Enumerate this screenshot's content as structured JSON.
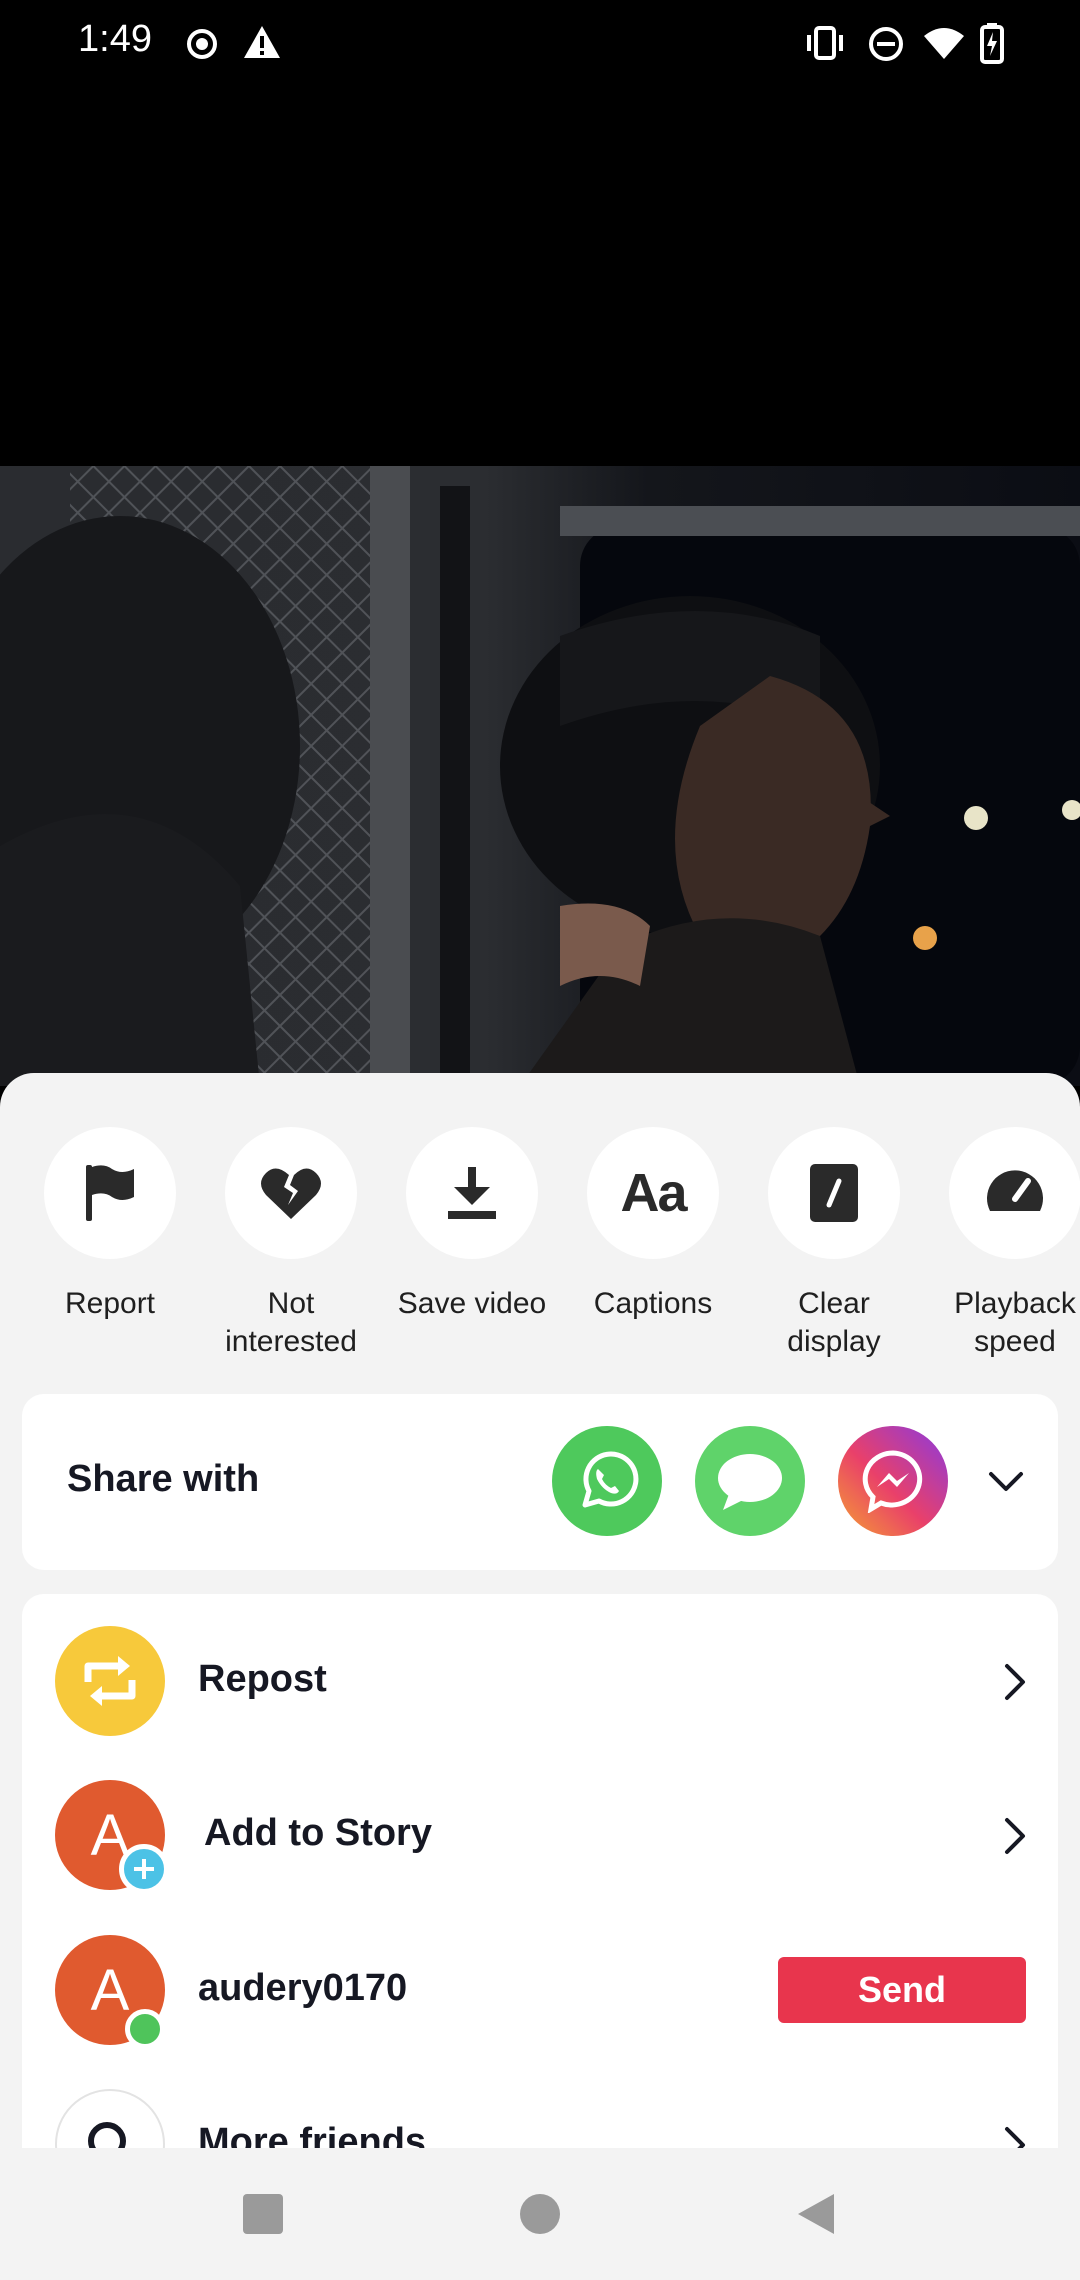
{
  "status_bar": {
    "time": "1:49",
    "left_icons": [
      "record-icon",
      "warning-icon"
    ],
    "right_icons": [
      "vibrate-icon",
      "do-not-disturb-icon",
      "wifi-icon",
      "battery-charging-icon"
    ]
  },
  "video": {
    "description_icon": "video-frame"
  },
  "actions": [
    {
      "label": "Report",
      "icon": "flag-icon"
    },
    {
      "label": "Not\ninterested",
      "icon": "broken-heart-icon"
    },
    {
      "label": "Save video",
      "icon": "download-icon"
    },
    {
      "label": "Captions",
      "icon": "captions-icon",
      "glyph": "Aa"
    },
    {
      "label": "Clear\ndisplay",
      "icon": "clear-display-icon"
    },
    {
      "label": "Playback\nspeed",
      "icon": "speedometer-icon"
    }
  ],
  "share": {
    "title": "Share with",
    "apps": [
      {
        "name": "whatsapp",
        "color": "#4ec95c"
      },
      {
        "name": "messages",
        "color": "#5fd36a"
      },
      {
        "name": "messenger",
        "color": "#a33fd6"
      }
    ]
  },
  "list": {
    "repost": {
      "label": "Repost",
      "color": "#f7c93b"
    },
    "story": {
      "label": "Add to Story",
      "avatar_letter": "A",
      "color": "#e05a2f"
    },
    "friend": {
      "label": "audery0170",
      "avatar_letter": "A",
      "color": "#e05a2f",
      "send_label": "Send"
    },
    "more": {
      "label": "More friends"
    }
  },
  "colors": {
    "accent": "#e8354d",
    "sheet_bg": "#f3f3f3"
  }
}
